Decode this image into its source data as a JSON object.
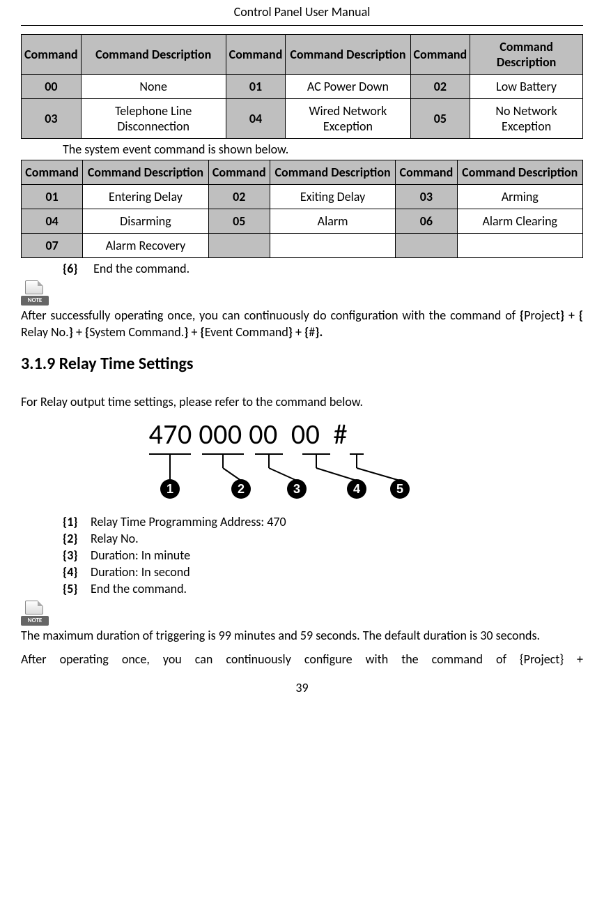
{
  "header": "Control Panel User Manual",
  "table1": {
    "headers": [
      "Command",
      "Command Description",
      "Command",
      "Command Description",
      "Command",
      "Command Description"
    ],
    "rows": [
      [
        "00",
        "None",
        "01",
        "AC Power Down",
        "02",
        "Low Battery"
      ],
      [
        "03",
        "Telephone Line Disconnection",
        "04",
        "Wired Network Exception",
        "05",
        "No Network Exception"
      ]
    ]
  },
  "caption1": "The system event command is shown below.",
  "table2": {
    "headers": [
      "Command",
      "Command Description",
      "Command",
      "Command Description",
      "Command",
      "Command Description"
    ],
    "rows": [
      [
        "01",
        "Entering Delay",
        "02",
        "Exiting Delay",
        "03",
        "Arming"
      ],
      [
        "04",
        "Disarming",
        "05",
        "Alarm",
        "06",
        "Alarm Clearing"
      ],
      [
        "07",
        "Alarm Recovery",
        "",
        "",
        "",
        ""
      ]
    ]
  },
  "item6": {
    "label": "{6}",
    "text": "End the command."
  },
  "noteLabel": "NOTE",
  "note1a": "After successfully operating once, you can continuously do configuration with the command of ",
  "note1b": "{",
  "note1c": "Project",
  "note1d": "}",
  "note1e": " + ",
  "note1f": "{",
  "note1g": " Relay No.",
  "note1h": "}",
  "note1i": " + ",
  "note1j": "{",
  "note1k": "System Command.",
  "note1l": "}",
  "note1m": " + ",
  "note1n": "{",
  "note1o": "Event Command",
  "note1p": "}",
  "note1q": " + ",
  "note1r": "{",
  "note1s": "#",
  "note1t": "}.",
  "section": "3.1.9   Relay Time Settings",
  "intro": "For Relay output time settings, please refer to the command below.",
  "diagram": {
    "parts": [
      "470",
      "000",
      "00",
      "00",
      "#"
    ],
    "labels": [
      "1",
      "2",
      "3",
      "4",
      "5"
    ]
  },
  "items": [
    {
      "label": "{1}",
      "text": "Relay Time Programming Address: 470"
    },
    {
      "label": "{2}",
      "text": "Relay No."
    },
    {
      "label": "{3}",
      "text": "Duration: In minute"
    },
    {
      "label": "{4}",
      "text": "Duration: In second"
    },
    {
      "label": "{5}",
      "text": "End the command."
    }
  ],
  "note2a": "The maximum duration of triggering is 99 minutes and 59 seconds. The default duration is 30 seconds.",
  "note2b": "After  operating  once,  you  can  continuously  configure  with  the  command  of  {Project}  +",
  "pageNum": "39"
}
